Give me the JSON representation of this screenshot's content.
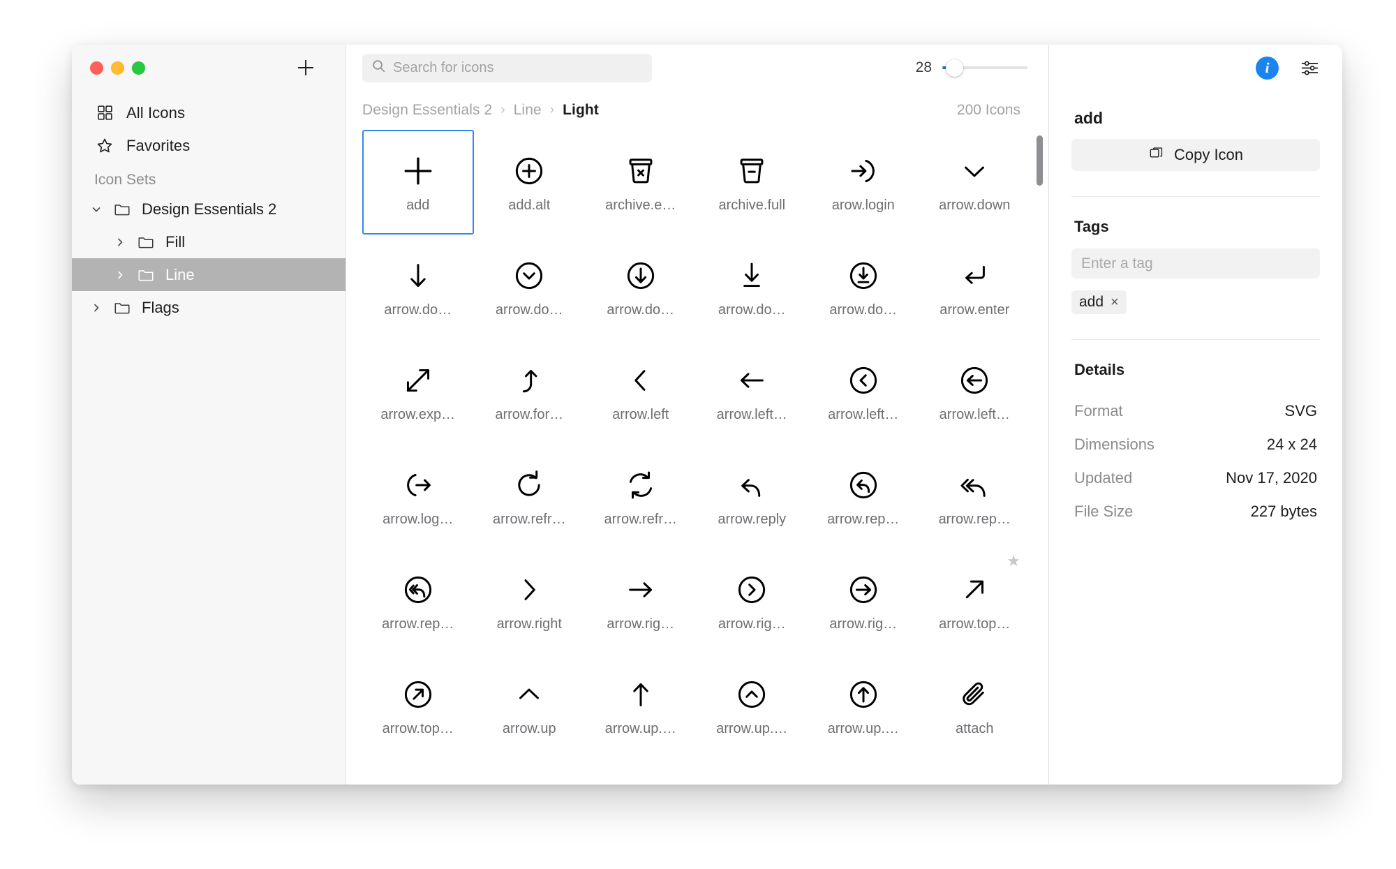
{
  "window": {
    "traffic_lights": {
      "close_color": "#ff5f57",
      "minimize_color": "#febc2e",
      "maximize_color": "#28c840"
    },
    "add_set_label": "+"
  },
  "sidebar": {
    "nav": [
      {
        "id": "all-icons",
        "label": "All Icons",
        "icon": "grid-icon"
      },
      {
        "id": "favorites",
        "label": "Favorites",
        "icon": "star-icon"
      }
    ],
    "section_header": "Icon Sets",
    "tree": [
      {
        "id": "design-essentials-2",
        "label": "Design Essentials 2",
        "level": 1,
        "expanded": true,
        "selected": false
      },
      {
        "id": "fill",
        "label": "Fill",
        "level": 2,
        "expanded": false,
        "selected": false
      },
      {
        "id": "line",
        "label": "Line",
        "level": 2,
        "expanded": false,
        "selected": true
      },
      {
        "id": "flags",
        "label": "Flags",
        "level": 1,
        "expanded": false,
        "selected": false
      }
    ]
  },
  "toolbar": {
    "search": {
      "placeholder": "Search for icons",
      "value": ""
    },
    "zoom": {
      "value": "28",
      "min": 16,
      "max": 128,
      "fill_percent": 8
    }
  },
  "breadcrumb": {
    "items": [
      "Design Essentials 2",
      "Line",
      "Light"
    ],
    "separator": "›",
    "active_index": 2
  },
  "grid": {
    "count_label": "200 Icons",
    "selected_id": "add",
    "icons": [
      {
        "id": "add",
        "label": "add",
        "glyph": "plus",
        "selected": true,
        "favorite": false
      },
      {
        "id": "add-alt",
        "label": "add.alt",
        "glyph": "plus-circle",
        "selected": false,
        "favorite": false
      },
      {
        "id": "archive-e",
        "label": "archive.e…",
        "glyph": "archive-x",
        "selected": false,
        "favorite": false
      },
      {
        "id": "archive-full",
        "label": "archive.full",
        "glyph": "archive-minus",
        "selected": false,
        "favorite": false
      },
      {
        "id": "arow-login",
        "label": "arow.login",
        "glyph": "arrow-login",
        "selected": false,
        "favorite": false
      },
      {
        "id": "arrow-down",
        "label": "arrow.down",
        "glyph": "chevron-down",
        "selected": false,
        "favorite": false
      },
      {
        "id": "arrow-do-1",
        "label": "arrow.do…",
        "glyph": "arrow-down",
        "selected": false,
        "favorite": false
      },
      {
        "id": "arrow-do-2",
        "label": "arrow.do…",
        "glyph": "chevron-down-circle",
        "selected": false,
        "favorite": false
      },
      {
        "id": "arrow-do-3",
        "label": "arrow.do…",
        "glyph": "arrow-down-circle",
        "selected": false,
        "favorite": false
      },
      {
        "id": "arrow-do-4",
        "label": "arrow.do…",
        "glyph": "arrow-down-line",
        "selected": false,
        "favorite": false
      },
      {
        "id": "arrow-do-5",
        "label": "arrow.do…",
        "glyph": "arrow-down-line-circle",
        "selected": false,
        "favorite": false
      },
      {
        "id": "arrow-enter",
        "label": "arrow.enter",
        "glyph": "arrow-enter",
        "selected": false,
        "favorite": false
      },
      {
        "id": "arrow-exp",
        "label": "arrow.exp…",
        "glyph": "arrow-expand",
        "selected": false,
        "favorite": false
      },
      {
        "id": "arrow-for",
        "label": "arrow.for…",
        "glyph": "arrow-forward",
        "selected": false,
        "favorite": false
      },
      {
        "id": "arrow-left",
        "label": "arrow.left",
        "glyph": "chevron-left",
        "selected": false,
        "favorite": false
      },
      {
        "id": "arrow-left-2",
        "label": "arrow.left…",
        "glyph": "arrow-left",
        "selected": false,
        "favorite": false
      },
      {
        "id": "arrow-left-3",
        "label": "arrow.left…",
        "glyph": "chevron-left-circle",
        "selected": false,
        "favorite": false
      },
      {
        "id": "arrow-left-4",
        "label": "arrow.left…",
        "glyph": "arrow-left-circle",
        "selected": false,
        "favorite": false
      },
      {
        "id": "arrow-log",
        "label": "arrow.log…",
        "glyph": "arrow-logout",
        "selected": false,
        "favorite": false
      },
      {
        "id": "arrow-refr-1",
        "label": "arrow.refr…",
        "glyph": "refresh",
        "selected": false,
        "favorite": false
      },
      {
        "id": "arrow-refr-2",
        "label": "arrow.refr…",
        "glyph": "refresh-double",
        "selected": false,
        "favorite": false
      },
      {
        "id": "arrow-reply",
        "label": "arrow.reply",
        "glyph": "reply",
        "selected": false,
        "favorite": false
      },
      {
        "id": "arrow-rep-2",
        "label": "arrow.rep…",
        "glyph": "reply-circle",
        "selected": false,
        "favorite": false
      },
      {
        "id": "arrow-rep-3",
        "label": "arrow.rep…",
        "glyph": "reply-all",
        "selected": false,
        "favorite": false
      },
      {
        "id": "arrow-rep-4",
        "label": "arrow.rep…",
        "glyph": "reply-all-circle",
        "selected": false,
        "favorite": false
      },
      {
        "id": "arrow-right",
        "label": "arrow.right",
        "glyph": "chevron-right",
        "selected": false,
        "favorite": false
      },
      {
        "id": "arrow-rig-2",
        "label": "arrow.rig…",
        "glyph": "arrow-right",
        "selected": false,
        "favorite": false
      },
      {
        "id": "arrow-rig-3",
        "label": "arrow.rig…",
        "glyph": "chevron-right-circle",
        "selected": false,
        "favorite": false
      },
      {
        "id": "arrow-rig-4",
        "label": "arrow.rig…",
        "glyph": "arrow-right-circle",
        "selected": false,
        "favorite": false
      },
      {
        "id": "arrow-top",
        "label": "arrow.top…",
        "glyph": "arrow-top-right",
        "selected": false,
        "favorite": true
      },
      {
        "id": "arrow-top-2",
        "label": "arrow.top…",
        "glyph": "arrow-top-right-circle",
        "selected": false,
        "favorite": false
      },
      {
        "id": "arrow-up",
        "label": "arrow.up",
        "glyph": "chevron-up",
        "selected": false,
        "favorite": false
      },
      {
        "id": "arrow-up-2",
        "label": "arrow.up.…",
        "glyph": "arrow-up",
        "selected": false,
        "favorite": false
      },
      {
        "id": "arrow-up-3",
        "label": "arrow.up.…",
        "glyph": "chevron-up-circle",
        "selected": false,
        "favorite": false
      },
      {
        "id": "arrow-up-4",
        "label": "arrow.up.…",
        "glyph": "arrow-up-circle",
        "selected": false,
        "favorite": false
      },
      {
        "id": "attach",
        "label": "attach",
        "glyph": "paperclip",
        "selected": false,
        "favorite": false
      }
    ]
  },
  "inspector": {
    "title": "add",
    "copy_button_label": "Copy Icon",
    "info_badge_label": "i",
    "tags_section_title": "Tags",
    "tag_placeholder": "Enter a tag",
    "tag_value": "",
    "tags": [
      {
        "label": "add",
        "remove": "×"
      }
    ],
    "details_section_title": "Details",
    "details": [
      {
        "label": "Format",
        "value": "SVG"
      },
      {
        "label": "Dimensions",
        "value": "24 x 24"
      },
      {
        "label": "Updated",
        "value": "Nov 17, 2020"
      },
      {
        "label": "File Size",
        "value": "227 bytes"
      }
    ]
  },
  "colors": {
    "accent": "#1a84f0",
    "selection_border": "#2f8bea",
    "sidebar_selection": "#b3b3b3"
  }
}
